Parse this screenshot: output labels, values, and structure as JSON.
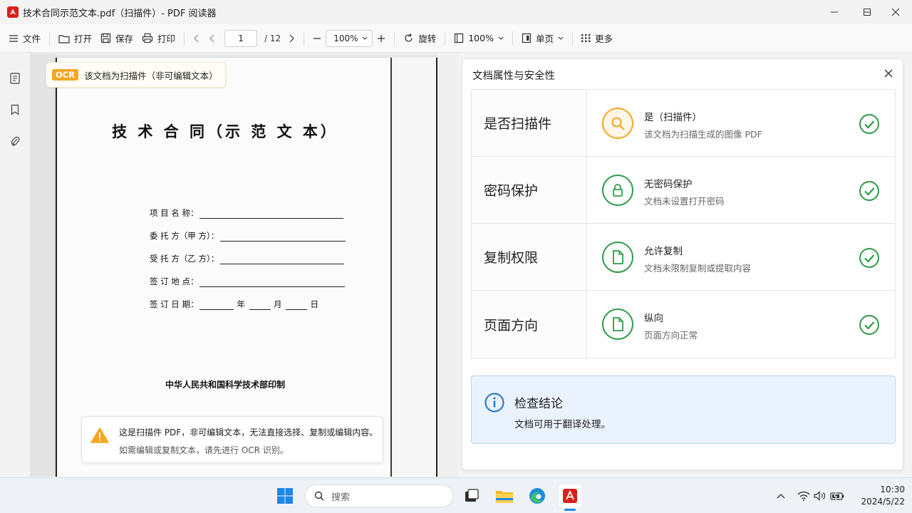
{
  "window": {
    "title": "技术合同示范文本.pdf（扫描件）- PDF 阅读器"
  },
  "toolbar": {
    "file_label": "文件",
    "open_label": "打开",
    "save_label": "保存",
    "print_label": "打印",
    "page_current": "1",
    "page_total": "/ 12",
    "zoom_value": "100%",
    "rotate_label": "旋转",
    "fit_label": "100%",
    "view_mode_label": "单页",
    "more_label": "更多"
  },
  "ocr_notice": {
    "badge": "OCR",
    "text": "该文档为扫描件（非可编辑文本）"
  },
  "document": {
    "title": "技 术 合 同（示 范 文 本）",
    "fields": [
      "项 目 名 称：",
      "委 托 方（甲 方）：",
      "受 托 方（乙 方）：",
      "签 订 地 点：",
      "签 订 日 期："
    ],
    "date_year": "年",
    "date_month": "月",
    "date_day": "日",
    "footer": "中华人民共和国科学技术部印制"
  },
  "warning": {
    "line1": "这是扫描件 PDF，非可编辑文本，无法直接选择、复制或编辑内容。",
    "line2": "如需编辑或复制文本，请先进行 OCR 识别。"
  },
  "panel": {
    "title": "文档属性与安全性",
    "rows": [
      {
        "label": "是否扫描件",
        "value": "是（扫描件）",
        "desc": "该文档为扫描生成的图像 PDF",
        "icon": "search-icon",
        "color": "#f5a623"
      },
      {
        "label": "密码保护",
        "value": "无密码保护",
        "desc": "文档未设置打开密码",
        "icon": "lock-icon",
        "color": "#2e9b47"
      },
      {
        "label": "复制权限",
        "value": "允许复制",
        "desc": "文档未限制复制或提取内容",
        "icon": "document-icon",
        "color": "#2e9b47"
      },
      {
        "label": "页面方向",
        "value": "纵向",
        "desc": "页面方向正常",
        "icon": "document-icon",
        "color": "#2e9b47"
      }
    ],
    "conclusion_title": "检查结论",
    "conclusion_text": "文档可用于翻译处理。"
  },
  "taskbar": {
    "search_placeholder": "搜索",
    "time": "10:30",
    "date": "2024/5/22"
  }
}
